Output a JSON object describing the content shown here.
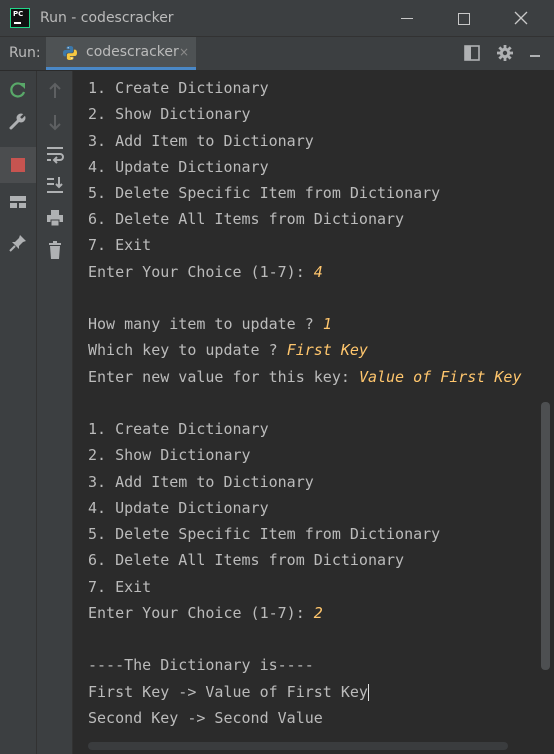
{
  "window": {
    "title": "Run - codescracker",
    "logo_text": "PC"
  },
  "toolbar": {
    "run_label": "Run:",
    "tab_label": "codescracker",
    "tab_close": "×"
  },
  "console": {
    "lines": [
      {
        "text": "1. Create Dictionary",
        "input": ""
      },
      {
        "text": "2. Show Dictionary",
        "input": ""
      },
      {
        "text": "3. Add Item to Dictionary",
        "input": ""
      },
      {
        "text": "4. Update Dictionary",
        "input": ""
      },
      {
        "text": "5. Delete Specific Item from Dictionary",
        "input": ""
      },
      {
        "text": "6. Delete All Items from Dictionary",
        "input": ""
      },
      {
        "text": "7. Exit",
        "input": ""
      },
      {
        "text": "Enter Your Choice (1-7): ",
        "input": "4"
      },
      {
        "text": "",
        "input": ""
      },
      {
        "text": "How many item to update ? ",
        "input": "1"
      },
      {
        "text": "Which key to update ? ",
        "input": "First Key"
      },
      {
        "text": "Enter new value for this key: ",
        "input": "Value of First Key"
      },
      {
        "text": "",
        "input": ""
      },
      {
        "text": "1. Create Dictionary",
        "input": ""
      },
      {
        "text": "2. Show Dictionary",
        "input": ""
      },
      {
        "text": "3. Add Item to Dictionary",
        "input": ""
      },
      {
        "text": "4. Update Dictionary",
        "input": ""
      },
      {
        "text": "5. Delete Specific Item from Dictionary",
        "input": ""
      },
      {
        "text": "6. Delete All Items from Dictionary",
        "input": ""
      },
      {
        "text": "7. Exit",
        "input": ""
      },
      {
        "text": "Enter Your Choice (1-7): ",
        "input": "2"
      },
      {
        "text": "",
        "input": ""
      },
      {
        "text": "----The Dictionary is----",
        "input": ""
      },
      {
        "text": "First Key -> Value of First Key",
        "input": ""
      },
      {
        "text": "Second Key -> Second Value",
        "input": ""
      }
    ]
  },
  "colors": {
    "background": "#2b2b2b",
    "panel": "#3c3f41",
    "text": "#bbbbbb",
    "user_input": "#ffc66d",
    "rerun_green": "#59a869",
    "stop_red": "#c75450"
  },
  "icons": {
    "rerun": "rerun-icon",
    "wrench": "wrench-icon",
    "stop": "stop-icon",
    "layout": "layout-icon",
    "pin": "pin-icon",
    "up": "arrow-up-icon",
    "down": "arrow-down-icon",
    "soft_wrap": "soft-wrap-icon",
    "scroll_end": "scroll-to-end-icon",
    "print": "print-icon",
    "trash": "trash-icon",
    "layout_top": "layout-icon",
    "settings": "gear-icon"
  }
}
